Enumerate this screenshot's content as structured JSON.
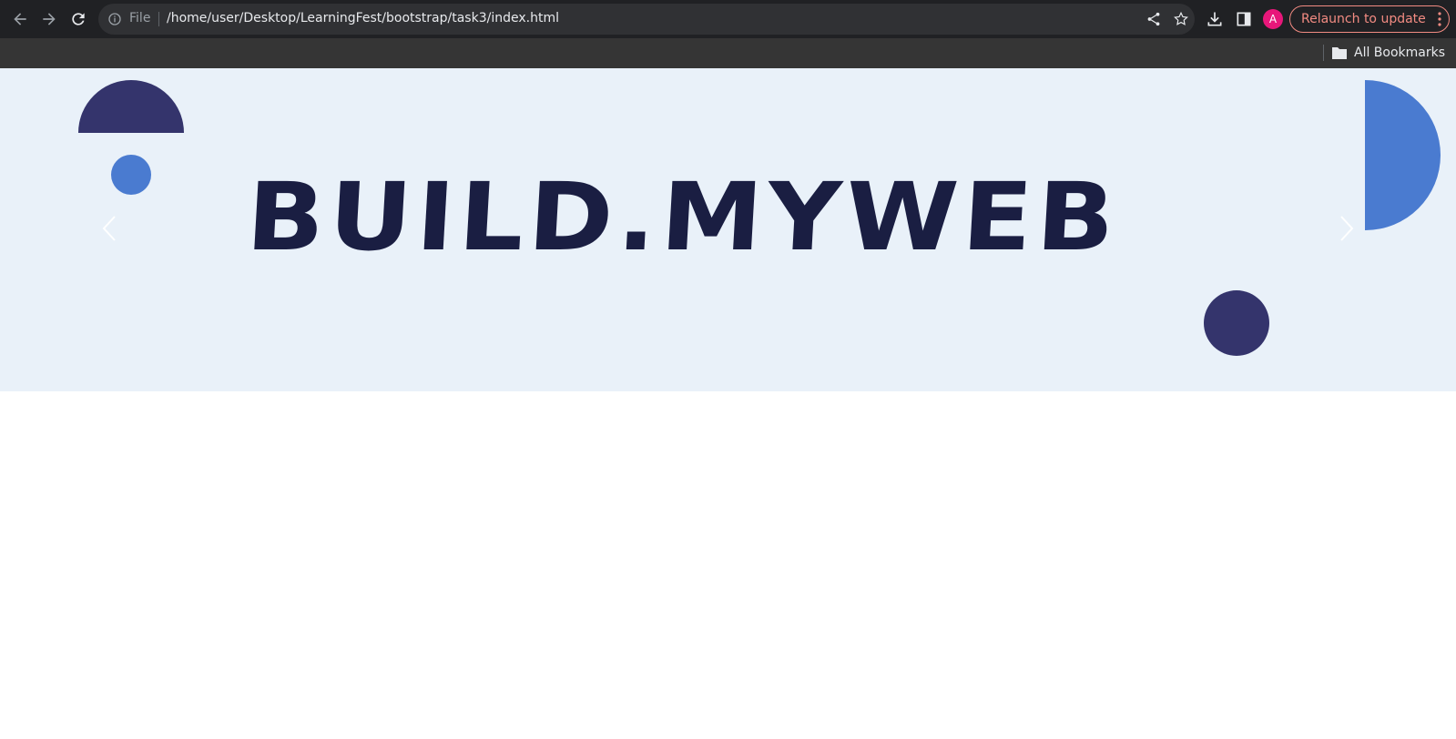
{
  "browser": {
    "omnibox": {
      "scheme_label": "File",
      "url": "/home/user/Desktop/LearningFest/bootstrap/task3/index.html"
    },
    "profile_initial": "A",
    "relaunch_label": "Relaunch to update",
    "bookmarks": {
      "all_label": "All Bookmarks"
    },
    "colors": {
      "toolbar": "#202124",
      "bookmarks_bar": "#353535",
      "relaunch": "#f28b82",
      "avatar": "#e8177a"
    }
  },
  "hero": {
    "brand": "BUILD.MYWEB",
    "background": "#e9f1f9",
    "colors": {
      "dark_shape": "#34346c",
      "light_shape": "#4a7bd0",
      "brand_text": "#1a1e42"
    }
  }
}
